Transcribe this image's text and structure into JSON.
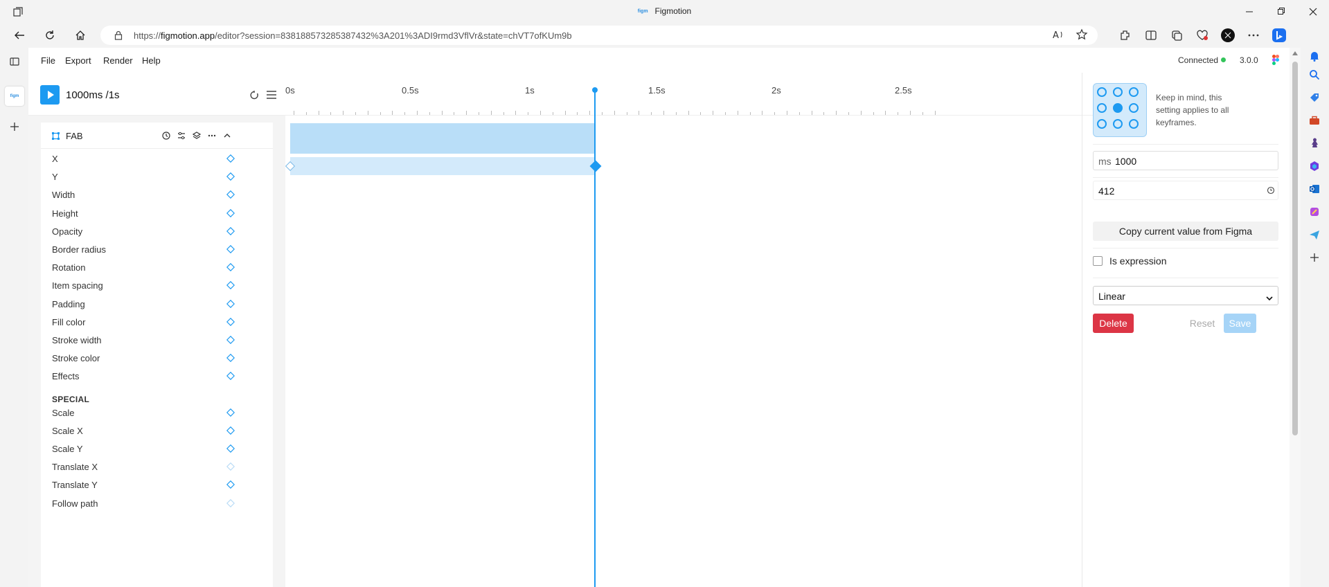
{
  "browser": {
    "window_title": "Figmotion",
    "favicon_text": "figm",
    "url_prefix": "https://",
    "url_host": "figmotion.app",
    "url_path": "/editor?session=838188573285387432%3A201%3ADI9rmd3VflVr&state=chVT7ofKUm9b"
  },
  "menu": {
    "file": "File",
    "export": "Export",
    "render": "Render",
    "help": "Help",
    "connected": "Connected",
    "version": "3.0.0"
  },
  "playbar": {
    "time_readout": "1000ms /1s"
  },
  "layer": {
    "name": "FAB",
    "properties": [
      "X",
      "Y",
      "Width",
      "Height",
      "Opacity",
      "Border radius",
      "Rotation",
      "Item spacing",
      "Padding",
      "Fill color",
      "Stroke width",
      "Stroke color",
      "Effects"
    ],
    "special_title": "SPECIAL",
    "special_properties": [
      "Scale",
      "Scale X",
      "Scale Y",
      "Translate X",
      "Translate Y",
      "Follow path"
    ],
    "special_dimmed": [
      "Translate X",
      "Follow path"
    ]
  },
  "timeline": {
    "ticks": [
      "0s",
      "0.5s",
      "1s",
      "1.5s",
      "2s",
      "2.5s"
    ],
    "playhead_time_s": 1
  },
  "inspector": {
    "anchor_note": "Keep in mind, this setting applies to all keyframes.",
    "anchor_selected": "center",
    "duration_prefix": "ms",
    "duration_value": "1000",
    "value": "412",
    "copy_label": "Copy current value from Figma",
    "is_expression_label": "Is expression",
    "easing": "Linear",
    "delete_label": "Delete",
    "reset_label": "Reset",
    "save_label": "Save"
  },
  "colors": {
    "accent": "#1d9af1",
    "danger": "#dc3545",
    "connected": "#33c45a"
  }
}
